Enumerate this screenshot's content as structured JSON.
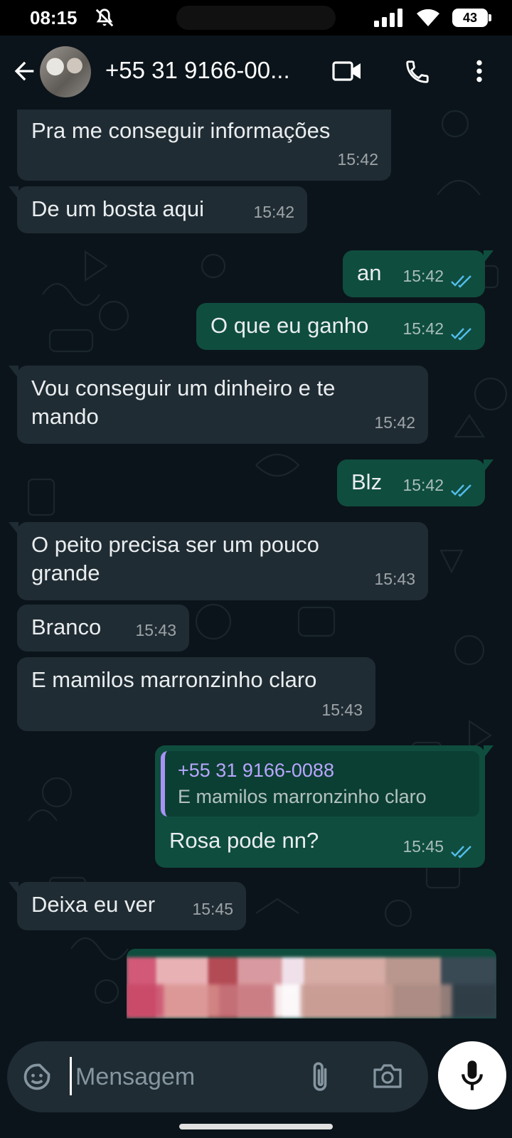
{
  "status_bar": {
    "time": "08:15",
    "battery": "43"
  },
  "header": {
    "contact_name": "+55 31 9166-00..."
  },
  "messages": [
    {
      "direction": "in",
      "text": "Pra me conseguir informações",
      "time": "15:42"
    },
    {
      "direction": "in",
      "text": "De um bosta aqui",
      "time": "15:42"
    },
    {
      "direction": "out",
      "text": "an",
      "time": "15:42"
    },
    {
      "direction": "out",
      "text": "O que eu ganho",
      "time": "15:42"
    },
    {
      "direction": "in",
      "text": "Vou conseguir um dinheiro e te mando",
      "time": "15:42"
    },
    {
      "direction": "out",
      "text": "Blz",
      "time": "15:42"
    },
    {
      "direction": "in",
      "text": "O peito precisa ser um pouco grande",
      "time": "15:43"
    },
    {
      "direction": "in",
      "text": "Branco",
      "time": "15:43"
    },
    {
      "direction": "in",
      "text": "E mamilos marronzinho claro",
      "time": "15:43"
    },
    {
      "direction": "out",
      "text": "Rosa pode nn?",
      "time": "15:45",
      "reply_to": {
        "author": "+55 31 9166-0088",
        "text": "E mamilos marronzinho claro"
      }
    },
    {
      "direction": "in",
      "text": "Deixa eu ver",
      "time": "15:45"
    }
  ],
  "composer": {
    "placeholder": "Mensagem"
  },
  "colors": {
    "background": "#0b141a",
    "incoming_bubble": "#202c33",
    "outgoing_bubble": "#0f4d3f",
    "read_ticks": "#53bdeb",
    "reply_bar": "#a992f5"
  },
  "icons": [
    "back-arrow-icon",
    "video-call-icon",
    "phone-icon",
    "more-options-icon",
    "sticker-icon",
    "attach-icon",
    "camera-icon",
    "mic-icon",
    "bell-off-icon",
    "signal-icon",
    "wifi-icon"
  ]
}
